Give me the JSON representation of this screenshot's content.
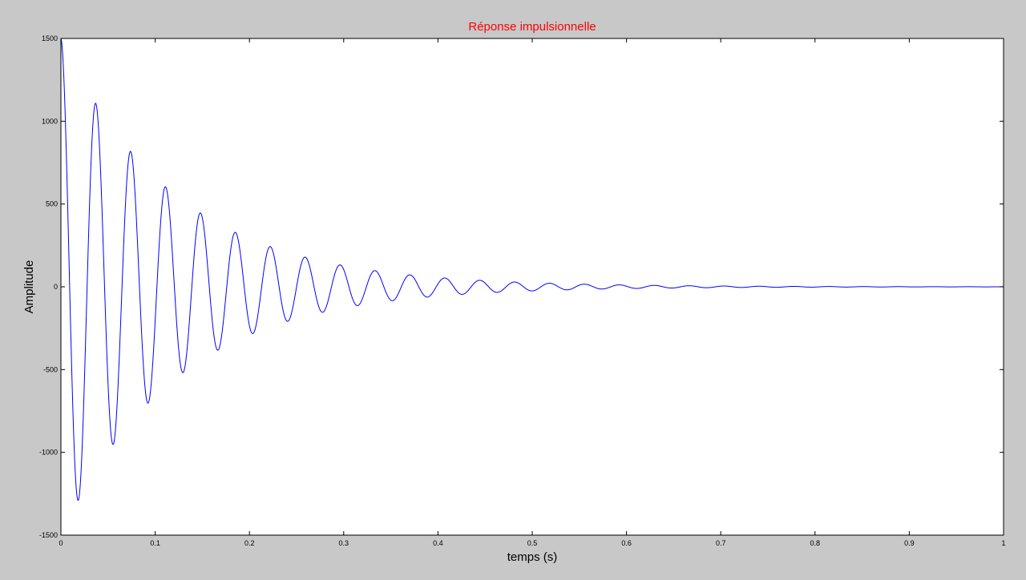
{
  "chart_data": {
    "type": "line",
    "title": "Réponse impulsionnelle",
    "xlabel": "temps (s)",
    "ylabel": "Amplitude",
    "xlim": [
      0,
      1
    ],
    "ylim": [
      -1500,
      1500
    ],
    "xticks": [
      0,
      0.1,
      0.2,
      0.3,
      0.4,
      0.5,
      0.6,
      0.7,
      0.8,
      0.9,
      1
    ],
    "xtick_labels": [
      "0",
      "0.1",
      "0.2",
      "0.3",
      "0.4",
      "0.5",
      "0.6",
      "0.7",
      "0.8",
      "0.9",
      "1"
    ],
    "yticks": [
      -1500,
      -1000,
      -500,
      0,
      500,
      1000,
      1500
    ],
    "ytick_labels": [
      "-1500",
      "-1000",
      "-500",
      "0",
      "500",
      "1000",
      "1500"
    ],
    "grid": false,
    "series": [
      {
        "color": "#0000ff",
        "description_points": {
          "x": [
            0,
            0.0185,
            0.037,
            0.0555,
            0.074,
            0.0925,
            0.111,
            0.1295,
            0.148,
            0.1665,
            0.185,
            0.2035,
            0.222,
            0.2405,
            0.259,
            0.2775,
            0.296,
            0.3145,
            0.333,
            0.3515,
            0.37,
            0.3885,
            0.407,
            0.4255,
            0.444,
            0.4625,
            0.481,
            0.4995,
            0.518,
            0.5365,
            0.555,
            0.5735,
            0.592,
            0.6105,
            0.629,
            0.6475,
            0.666,
            0.6845,
            0.703,
            0.7215,
            0.74,
            1.0
          ],
          "y": [
            1500,
            -1290,
            1115,
            -955,
            830,
            -710,
            615,
            -530,
            460,
            -395,
            340,
            -290,
            250,
            -215,
            185,
            -160,
            140,
            -120,
            105,
            -90,
            78,
            -67,
            58,
            -50,
            43,
            -37,
            32,
            -27,
            23,
            -20,
            17,
            -15,
            13,
            -11,
            10,
            -8,
            7,
            -6,
            5,
            -4,
            4,
            0
          ]
        },
        "model": {
          "amplitude": 1500,
          "frequency_hz": 27,
          "decay_per_s": 8.2,
          "x_start": 0,
          "x_end": 1
        }
      }
    ]
  },
  "colors": {
    "figure_background": "#c8c8c8",
    "axes_background": "#ffffff",
    "axes_frame": "#000000",
    "line": "#0000ff",
    "title": "#ff0000"
  }
}
